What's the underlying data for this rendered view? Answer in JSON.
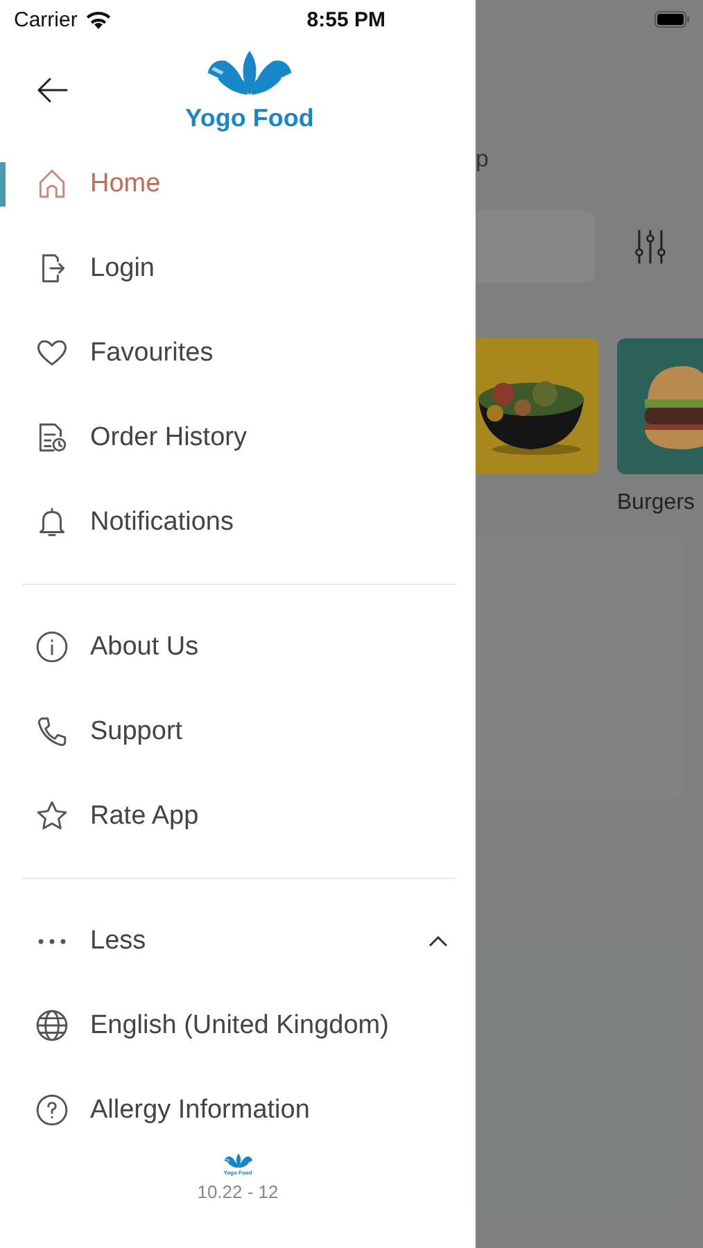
{
  "status_bar": {
    "carrier": "Carrier",
    "time": "8:55 PM"
  },
  "drawer": {
    "logo_text": "Yogo Food",
    "sections": [
      {
        "items": [
          {
            "kind": "home",
            "label": "Home",
            "selected": true
          },
          {
            "kind": "login",
            "label": "Login",
            "selected": false
          },
          {
            "kind": "heart",
            "label": "Favourites",
            "selected": false
          },
          {
            "kind": "history",
            "label": "Order History",
            "selected": false
          },
          {
            "kind": "bell",
            "label": "Notifications",
            "selected": false
          }
        ]
      },
      {
        "items": [
          {
            "kind": "info",
            "label": "About Us",
            "selected": false
          },
          {
            "kind": "phone",
            "label": "Support",
            "selected": false
          },
          {
            "kind": "star",
            "label": "Rate App",
            "selected": false
          }
        ]
      }
    ],
    "more": {
      "label": "Less",
      "expanded": true,
      "items": [
        {
          "kind": "globe",
          "label": "English (United Kingdom)",
          "selected": false
        },
        {
          "kind": "question",
          "label": "Allergy Information",
          "selected": false
        }
      ]
    },
    "footer": {
      "logo_text": "Yogo Food",
      "version": "10.22 - 12"
    }
  },
  "background": {
    "heading": "p",
    "category_label": "Burgers"
  }
}
